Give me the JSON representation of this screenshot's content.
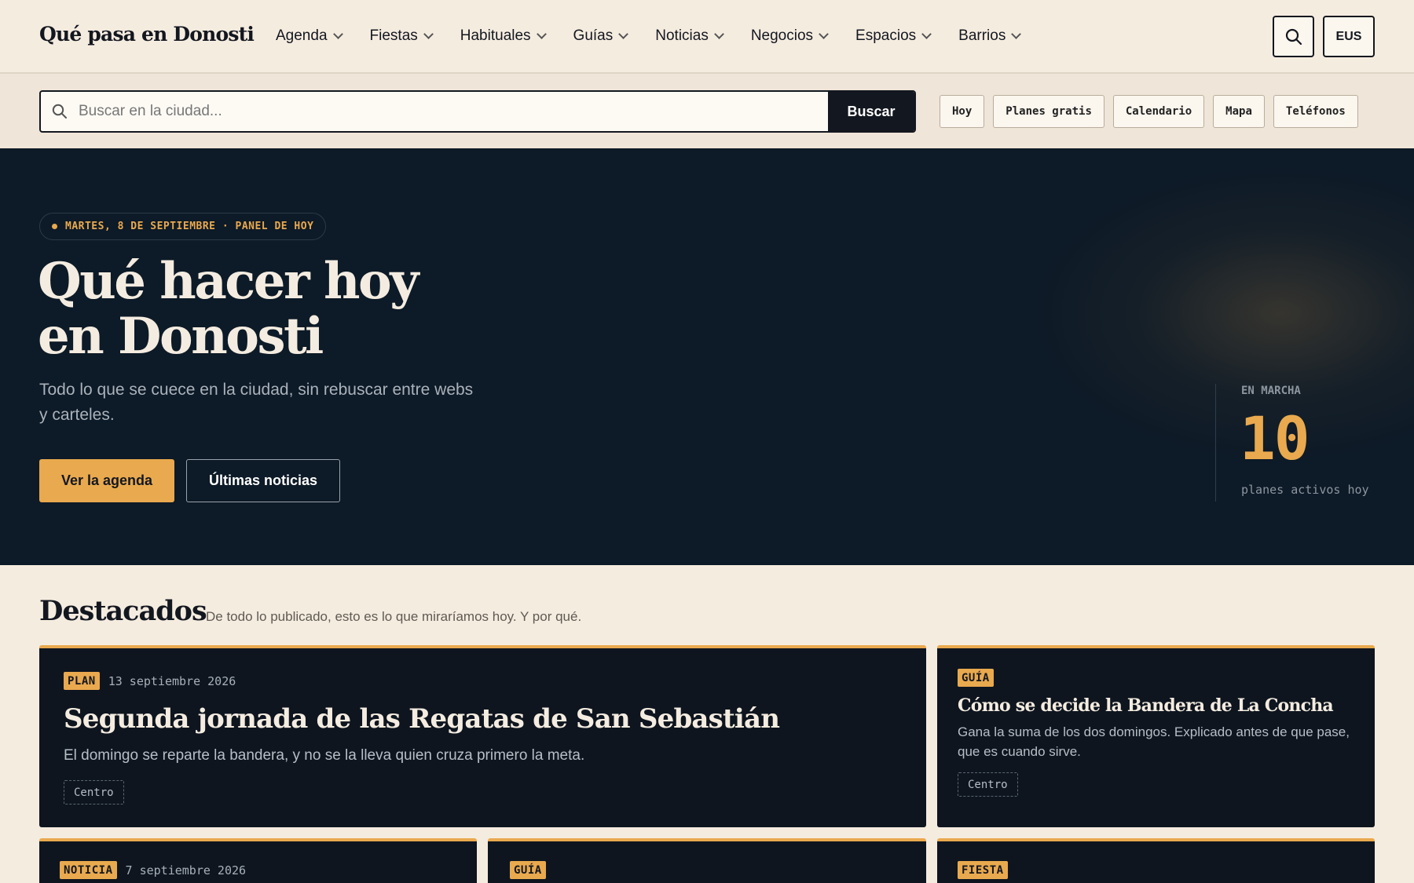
{
  "site": {
    "logo": "Qué pasa en Donosti"
  },
  "nav": {
    "items": [
      {
        "label": "Agenda"
      },
      {
        "label": "Fiestas"
      },
      {
        "label": "Habituales"
      },
      {
        "label": "Guías"
      },
      {
        "label": "Noticias"
      },
      {
        "label": "Negocios"
      },
      {
        "label": "Espacios"
      },
      {
        "label": "Barrios"
      }
    ],
    "lang_label": "EUS"
  },
  "search": {
    "placeholder": "Buscar en la ciudad...",
    "value": "",
    "button_label": "Buscar"
  },
  "quick_links": [
    "Hoy",
    "Planes gratis",
    "Calendario",
    "Mapa",
    "Teléfonos"
  ],
  "hero": {
    "badge": "MARTES, 8 DE SEPTIEMBRE · PANEL DE HOY",
    "title_line1": "Qué hacer hoy",
    "title_line2": "en Donosti",
    "subtitle": "Todo lo que se cuece en la ciudad, sin rebuscar entre webs y carteles.",
    "primary_cta": "Ver la agenda",
    "secondary_cta": "Últimas noticias",
    "live": {
      "label": "EN MARCHA",
      "count": "10",
      "description": "planes activos hoy"
    }
  },
  "featured": {
    "title": "Destacados",
    "subtitle": "De todo lo publicado, esto es lo que miraríamos hoy. Y por qué.",
    "cards": [
      {
        "tag": "PLAN",
        "date": "13 septiembre 2026",
        "title": "Segunda jornada de las Regatas de San Sebastián",
        "description": "El domingo se reparte la bandera, y no se la lleva quien cruza primero la meta.",
        "location": "Centro"
      },
      {
        "tag": "GUÍA",
        "date": "",
        "title": "Cómo se decide la Bandera de La Concha",
        "description": "Gana la suma de los dos domingos. Explicado antes de que pase, que es cuando sirve.",
        "location": "Centro"
      },
      {
        "tag": "NOTICIA",
        "date": "7 septiembre 2026"
      },
      {
        "tag": "GUÍA",
        "date": ""
      },
      {
        "tag": "FIESTA",
        "date": ""
      }
    ]
  },
  "colors": {
    "accent": "#e9a94e",
    "dark": "#0d1a27",
    "background": "#f5ece0"
  }
}
